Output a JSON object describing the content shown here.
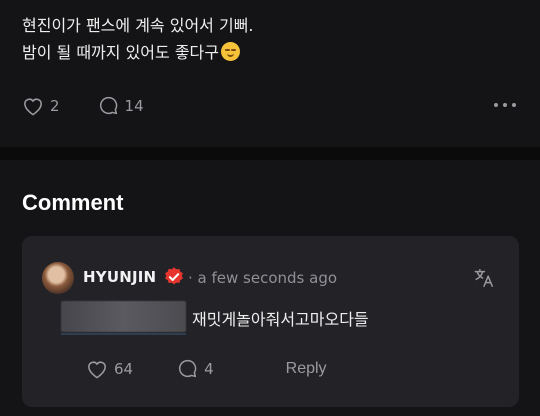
{
  "post": {
    "line1": "현진이가 팬스에 계속 있어서 기뻐.",
    "line2": "밤이 될 때까지 있어도 좋다구",
    "emoji": "smirking-face-emoji",
    "likes": "2",
    "comments": "14"
  },
  "comments_section": {
    "title": "Comment"
  },
  "comment": {
    "author": "HYUNJIN",
    "time": "· a few seconds ago",
    "text": "재밋게놀아줘서고마오다들",
    "likes": "64",
    "replies": "4",
    "reply_label": "Reply"
  },
  "colors": {
    "background": "#141416",
    "card": "#232327",
    "badge": "#e5352e",
    "muted": "#9a9aa0"
  }
}
